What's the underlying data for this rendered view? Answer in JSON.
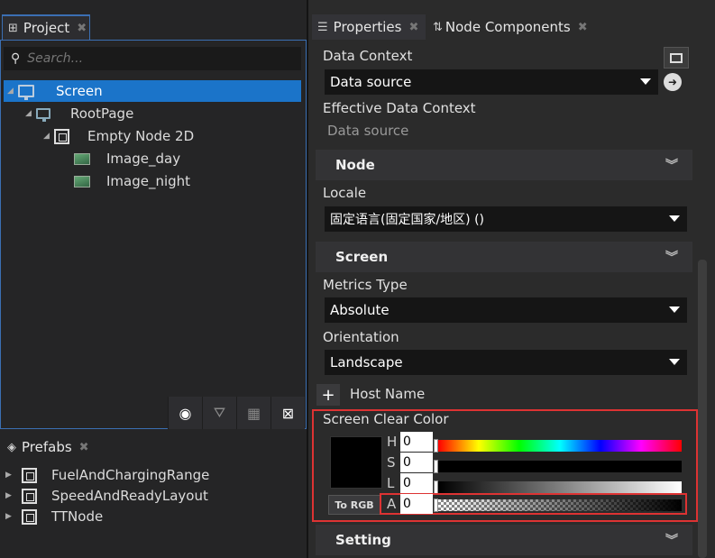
{
  "left_panel": {
    "project_tab": "Project",
    "search_placeholder": "Search...",
    "tree": [
      {
        "label": "Screen"
      },
      {
        "label": "RootPage"
      },
      {
        "label": "Empty Node 2D"
      },
      {
        "label": "Image_day"
      },
      {
        "label": "Image_night"
      }
    ],
    "prefabs_tab": "Prefabs",
    "prefabs": [
      {
        "label": "FuelAndChargingRange"
      },
      {
        "label": "SpeedAndReadyLayout"
      },
      {
        "label": "TTNode"
      }
    ]
  },
  "right_panel": {
    "tabs": [
      {
        "label": "Properties"
      },
      {
        "label": "Node Components"
      }
    ],
    "data_context_label": "Data Context",
    "data_context_value": "Data source",
    "effective_label": "Effective Data Context",
    "effective_value": "Data source",
    "section_node": "Node",
    "locale_label": "Locale",
    "locale_value": "固定语言(固定国家/地区) ()",
    "section_screen": "Screen",
    "metrics_label": "Metrics Type",
    "metrics_value": "Absolute",
    "orientation_label": "Orientation",
    "orientation_value": "Landscape",
    "host_name_label": "Host Name",
    "clear_color_label": "Screen Clear Color",
    "color": {
      "h_label": "H",
      "h_value": "0",
      "s_label": "S",
      "s_value": "0",
      "l_label": "L",
      "l_value": "0",
      "a_label": "A",
      "a_value": "0",
      "to_rgb_label": "To RGB",
      "swatch_color": "#000000"
    },
    "section_setting": "Setting"
  }
}
